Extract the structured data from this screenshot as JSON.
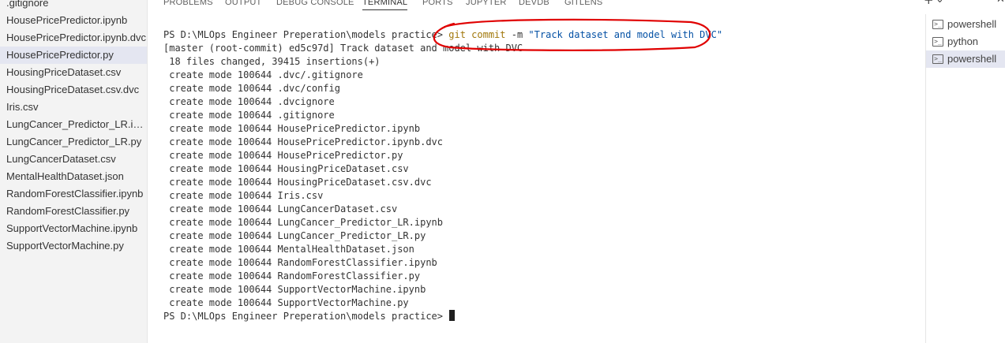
{
  "explorer": {
    "files": [
      ".gitignore",
      "HousePricePredictor.ipynb",
      "HousePricePredictor.ipynb.dvc",
      "HousePricePredictor.py",
      "HousingPriceDataset.csv",
      "HousingPriceDataset.csv.dvc",
      "Iris.csv",
      "LungCancer_Predictor_LR.ipynb",
      "LungCancer_Predictor_LR.py",
      "LungCancerDataset.csv",
      "MentalHealthDataset.json",
      "RandomForestClassifier.ipynb",
      "RandomForestClassifier.py",
      "SupportVectorMachine.ipynb",
      "SupportVectorMachine.py"
    ],
    "selected": "HousePricePredictor.py"
  },
  "panel": {
    "tabs": [
      "PROBLEMS",
      "OUTPUT",
      "DEBUG CONSOLE",
      "TERMINAL",
      "PORTS",
      "JUPYTER",
      "DEVDB",
      "GITLENS"
    ],
    "active_tab": "TERMINAL",
    "icons": {
      "new_terminal": "plus-icon",
      "dropdown": "chevron-down-icon",
      "more": "ellipsis-icon",
      "maximize": "chevron-up-icon",
      "close": "close-icon"
    },
    "glyphs": {
      "plus": "+",
      "chevron_down": "⌄",
      "ellipsis": "···",
      "chevron_up": "⌃",
      "close": "✕"
    }
  },
  "terminal": {
    "prompt": "PS D:\\MLOps Engineer Preperation\\models practice>",
    "command_name": "git commit",
    "command_flag": "-m",
    "command_string": "\"Track dataset and model with DVC\"",
    "output_lines": [
      "[master (root-commit) ed5c97d] Track dataset and model with DVC",
      " 18 files changed, 39415 insertions(+)",
      " create mode 100644 .dvc/.gitignore",
      " create mode 100644 .dvc/config",
      " create mode 100644 .dvcignore",
      " create mode 100644 .gitignore",
      " create mode 100644 HousePricePredictor.ipynb",
      " create mode 100644 HousePricePredictor.ipynb.dvc",
      " create mode 100644 HousePricePredictor.py",
      " create mode 100644 HousingPriceDataset.csv",
      " create mode 100644 HousingPriceDataset.csv.dvc",
      " create mode 100644 Iris.csv",
      " create mode 100644 LungCancerDataset.csv",
      " create mode 100644 LungCancer_Predictor_LR.ipynb",
      " create mode 100644 LungCancer_Predictor_LR.py",
      " create mode 100644 MentalHealthDataset.json",
      " create mode 100644 RandomForestClassifier.ipynb",
      " create mode 100644 RandomForestClassifier.py",
      " create mode 100644 SupportVectorMachine.ipynb",
      " create mode 100644 SupportVectorMachine.py"
    ],
    "final_prompt": "PS D:\\MLOps Engineer Preperation\\models practice>"
  },
  "terminal_list": {
    "items": [
      {
        "label": "powershell",
        "icon": "terminal-icon"
      },
      {
        "label": "python",
        "icon": "terminal-icon"
      },
      {
        "label": "powershell",
        "icon": "terminal-icon"
      }
    ],
    "active_index": 2
  },
  "annotation": {
    "color": "#e00000"
  },
  "colors": {
    "command": "#a1770a",
    "string": "#0451a5",
    "selection": "#e4e6f1",
    "sidebar_bg": "#f3f3f3"
  }
}
